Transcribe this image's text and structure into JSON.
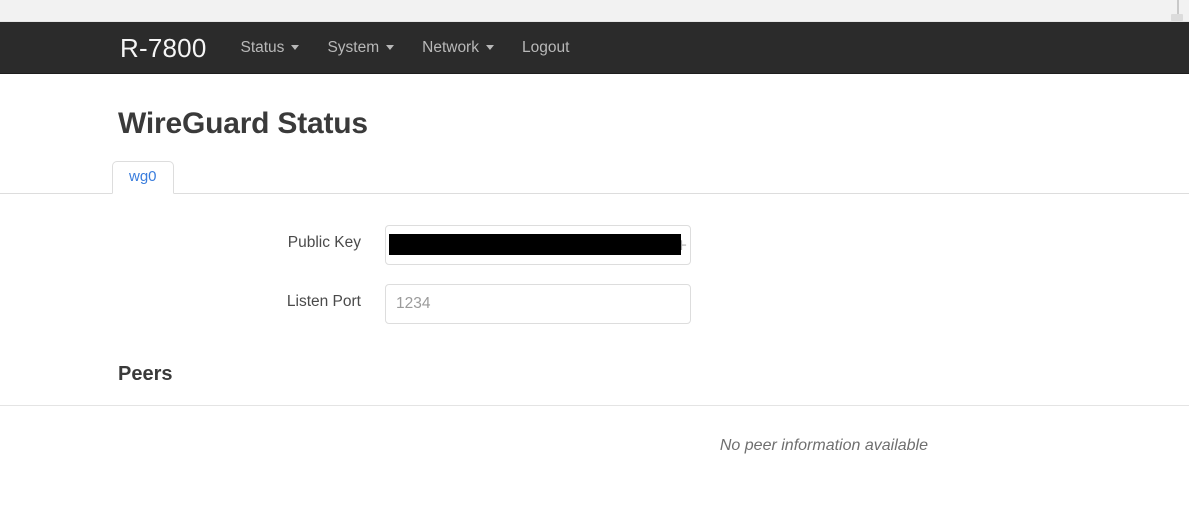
{
  "window": {
    "edge_marker": "resize-handle"
  },
  "navbar": {
    "brand": "R-7800",
    "background_color": "#2b2b2b",
    "link_color": "#b8b8b8",
    "items": [
      {
        "label": "Status",
        "has_caret": true
      },
      {
        "label": "System",
        "has_caret": true
      },
      {
        "label": "Network",
        "has_caret": true
      },
      {
        "label": "Logout",
        "has_caret": false
      }
    ]
  },
  "page": {
    "title": "WireGuard Status"
  },
  "tabs": {
    "active": "wg0",
    "active_color": "#3a7ddd",
    "items": [
      {
        "label": "wg0",
        "active": true
      }
    ]
  },
  "form": {
    "fields": [
      {
        "label": "Public Key",
        "value": "",
        "placeholder": "",
        "redacted": true,
        "tail_char": "⊦"
      },
      {
        "label": "Listen Port",
        "value": "",
        "placeholder": "1234",
        "redacted": false
      }
    ]
  },
  "peers": {
    "title": "Peers",
    "empty_message": "No peer information available"
  }
}
